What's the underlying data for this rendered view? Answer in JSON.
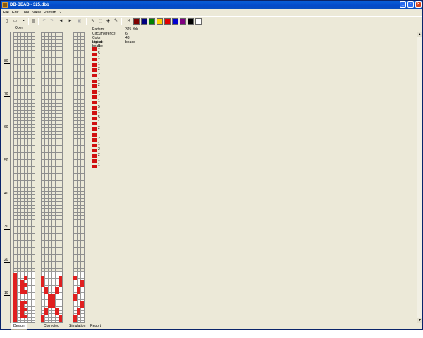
{
  "window": {
    "title": "DB-BEAD - 325.dbb"
  },
  "menu": [
    "File",
    "Edit",
    "Tool",
    "View",
    "Pattern",
    "?"
  ],
  "toolbar": {
    "icons": [
      "new-icon",
      "open-icon",
      "save-icon",
      "print-icon",
      "undo-icon",
      "redo-icon",
      "arrow-left-icon",
      "arrow-right-icon",
      "preview-icon",
      "pointer-icon",
      "select-icon",
      "fill-icon",
      "pipette-icon",
      "delete-icon"
    ],
    "colors": [
      "#800000",
      "#000080",
      "#008000",
      "#ffd000",
      "#e00000",
      "#0000d0",
      "#800080",
      "#000000",
      "#ffffff"
    ]
  },
  "panels": {
    "open_label": "Open"
  },
  "ruler": {
    "ticks": [
      "80",
      "70",
      "60",
      "50",
      "40",
      "30",
      "20",
      "10"
    ]
  },
  "report": {
    "pattern_label": "Pattern:",
    "pattern_value": "325.dbb",
    "circumference_label": "Circumference:",
    "circumference_value": "6",
    "color_repeat_label": "Color repeat:",
    "color_repeat_value": "48 beads",
    "list_label": "List of beads:",
    "top_count": "5",
    "bead_counts": [
      "1",
      "5",
      "1",
      "1",
      "2",
      "2",
      "1",
      "2",
      "1",
      "2",
      "1",
      "5",
      "1",
      "5",
      "1",
      "2",
      "1",
      "2",
      "1",
      "2",
      "2",
      "1",
      "1"
    ],
    "bead_color": "#d01010"
  },
  "tabs": [
    "Design",
    "Corrected",
    "Simulation",
    "Report"
  ]
}
